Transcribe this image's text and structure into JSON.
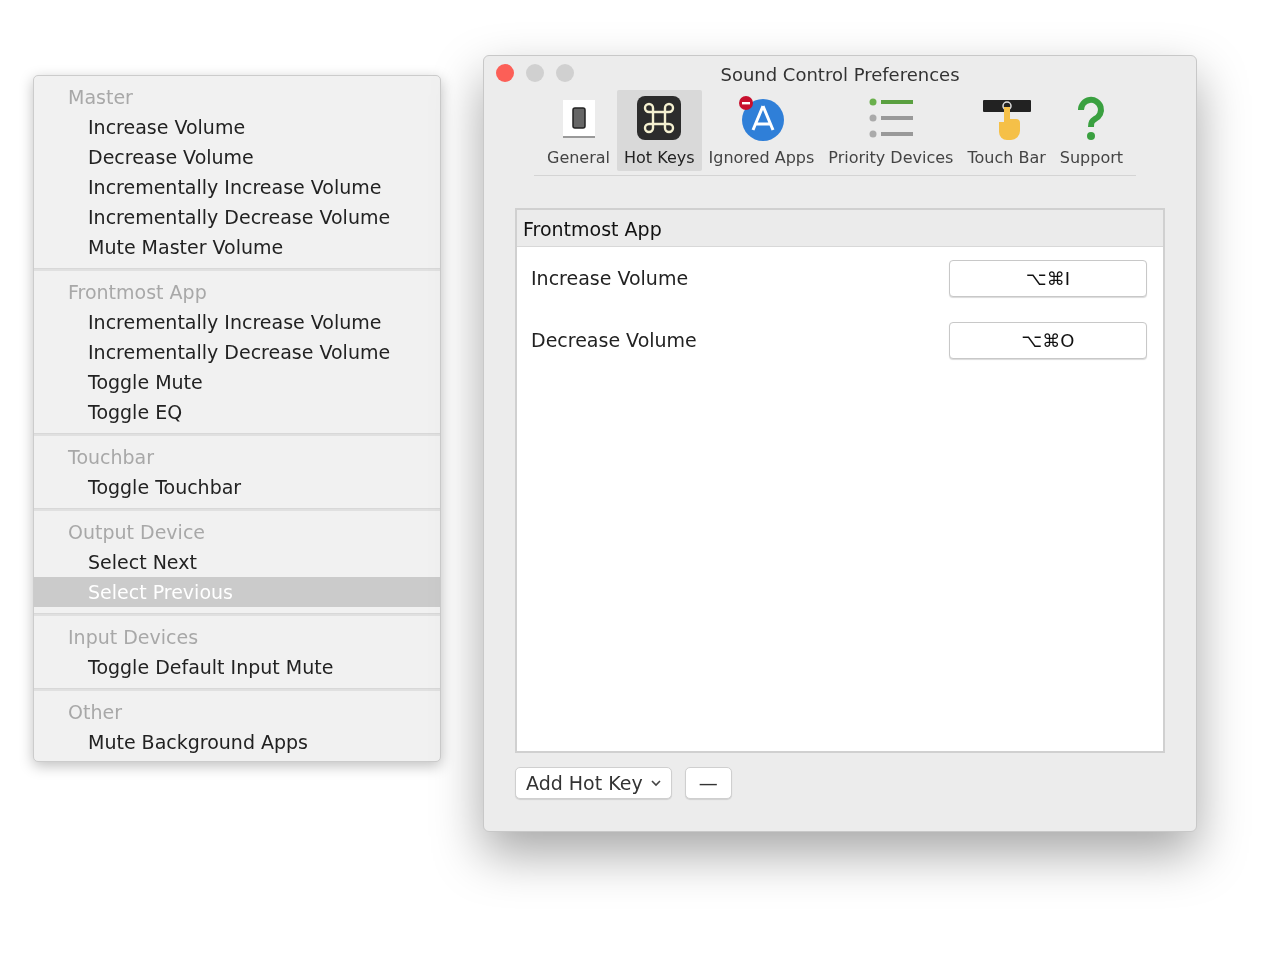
{
  "menu": {
    "sections": [
      {
        "title": "Master",
        "items": [
          {
            "label": "Increase Volume",
            "selected": false
          },
          {
            "label": "Decrease Volume",
            "selected": false
          },
          {
            "label": "Incrementally Increase Volume",
            "selected": false
          },
          {
            "label": "Incrementally Decrease Volume",
            "selected": false
          },
          {
            "label": "Mute Master Volume",
            "selected": false
          }
        ]
      },
      {
        "title": "Frontmost App",
        "items": [
          {
            "label": "Incrementally Increase Volume",
            "selected": false
          },
          {
            "label": "Incrementally Decrease Volume",
            "selected": false
          },
          {
            "label": "Toggle Mute",
            "selected": false
          },
          {
            "label": "Toggle EQ",
            "selected": false
          }
        ]
      },
      {
        "title": "Touchbar",
        "items": [
          {
            "label": "Toggle Touchbar",
            "selected": false
          }
        ]
      },
      {
        "title": "Output Device",
        "items": [
          {
            "label": "Select Next",
            "selected": false
          },
          {
            "label": "Select Previous",
            "selected": true
          }
        ]
      },
      {
        "title": "Input Devices",
        "items": [
          {
            "label": "Toggle Default Input Mute",
            "selected": false
          }
        ]
      },
      {
        "title": "Other",
        "items": [
          {
            "label": "Mute Background Apps",
            "selected": false
          }
        ]
      }
    ]
  },
  "window": {
    "title": "Sound Control Preferences"
  },
  "tabs": [
    {
      "label": "General",
      "kind": "switch",
      "selected": false
    },
    {
      "label": "Hot Keys",
      "kind": "command",
      "selected": true
    },
    {
      "label": "Ignored Apps",
      "kind": "appstore",
      "selected": false
    },
    {
      "label": "Priority Devices",
      "kind": "list",
      "selected": false
    },
    {
      "label": "Touch Bar",
      "kind": "touchbar",
      "selected": false
    },
    {
      "label": "Support",
      "kind": "question",
      "selected": false
    }
  ],
  "hotkeys": {
    "group": "Frontmost App",
    "rows": [
      {
        "action": "Increase Volume",
        "shortcut": "⌥⌘I"
      },
      {
        "action": "Decrease Volume",
        "shortcut": "⌥⌘O"
      }
    ]
  },
  "footer": {
    "add_button": "Add Hot Key",
    "remove_button": "—"
  }
}
